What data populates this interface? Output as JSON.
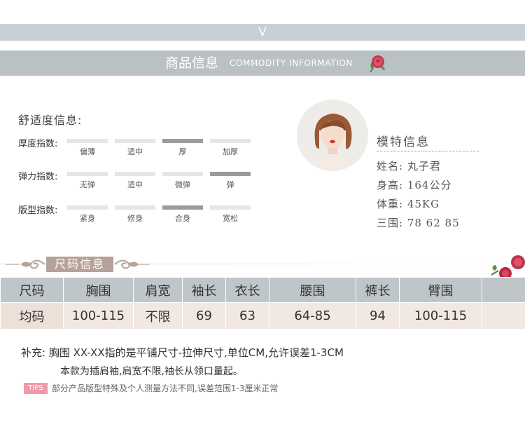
{
  "top_bar": {
    "chevron": "V"
  },
  "section_header": {
    "title_cn": "商品信息",
    "title_en": "COMMODITY INFORMATION"
  },
  "comfort": {
    "title": "舒适度信息:",
    "rows": [
      {
        "label": "厚度指数:",
        "options": [
          "偏薄",
          "适中",
          "厚",
          "加厚"
        ],
        "selected": 2
      },
      {
        "label": "弹力指数:",
        "options": [
          "无弹",
          "适中",
          "微弹",
          "弹"
        ],
        "selected": 3
      },
      {
        "label": "版型指数:",
        "options": [
          "紧身",
          "修身",
          "合身",
          "宽松"
        ],
        "selected": 2
      }
    ]
  },
  "model": {
    "title": "模特信息",
    "name": "姓名:  丸子君",
    "height": "身高:  164公分",
    "weight": "体重:  45KG",
    "measurements": "三围:  78  62  85"
  },
  "size_section": {
    "title": "尺码信息"
  },
  "size_table": {
    "headers": [
      "尺码",
      "胸围",
      "肩宽",
      "袖长",
      "衣长",
      "腰围",
      "裤长",
      "臂围",
      ""
    ],
    "rows": [
      [
        "均码",
        "100-115",
        "不限",
        "69",
        "63",
        "64-85",
        "94",
        "100-115",
        ""
      ]
    ]
  },
  "notes": {
    "line1": "补充:  胸围 XX-XX指的是平铺尺寸-拉伸尺寸,单位CM,允许误差1-3CM",
    "line2": "本款为插肩袖,肩宽不限,袖长从领口量起。",
    "tips_tag": "TIPS",
    "tips_text": "部分产品版型特殊及个人测量方法不同,误差范围1-3厘米正常"
  },
  "colors": {
    "header_bar": "#b9c1c4",
    "table_head": "#bfc6c9",
    "table_row": "#f2e8e2",
    "banner": "#b7a299",
    "tips": "#f09aa8",
    "rose": "#c8384e"
  }
}
